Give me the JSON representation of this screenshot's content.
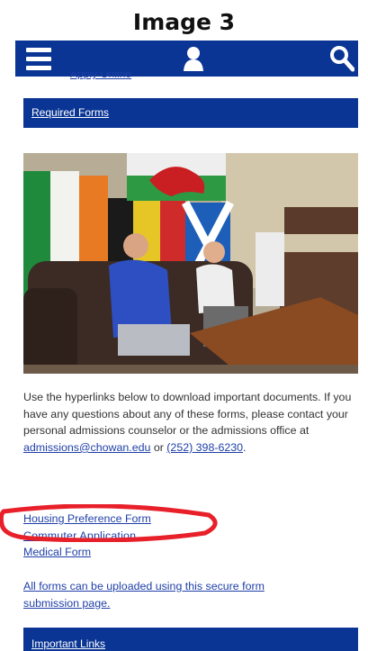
{
  "caption": "Image 3",
  "nav": {
    "menu_icon": "hamburger-menu-icon",
    "user_icon": "user-icon",
    "search_icon": "search-icon",
    "bar_color": "#0a3594"
  },
  "cut_off_link": "Apply Online",
  "required_forms": {
    "label": "Required Forms"
  },
  "photo": {
    "description_icon": "students-gaming-photo"
  },
  "intro": {
    "text_before": "Use the hyperlinks below to download important documents. If you have any questions about any of these forms, please contact your personal admissions counselor or the admissions office at ",
    "email": "admissions@chowan.edu",
    "text_middle": " or ",
    "phone": "(252) 398-6230",
    "text_after": "."
  },
  "forms": [
    {
      "label": "Housing Preference Form"
    },
    {
      "label": "Commuter Application"
    },
    {
      "label": "Medical Form"
    }
  ],
  "upload_note": "All forms can be uploaded using this secure form submission page.",
  "important_links": {
    "label": "Important Links"
  },
  "annotation_color": "#e8202a"
}
